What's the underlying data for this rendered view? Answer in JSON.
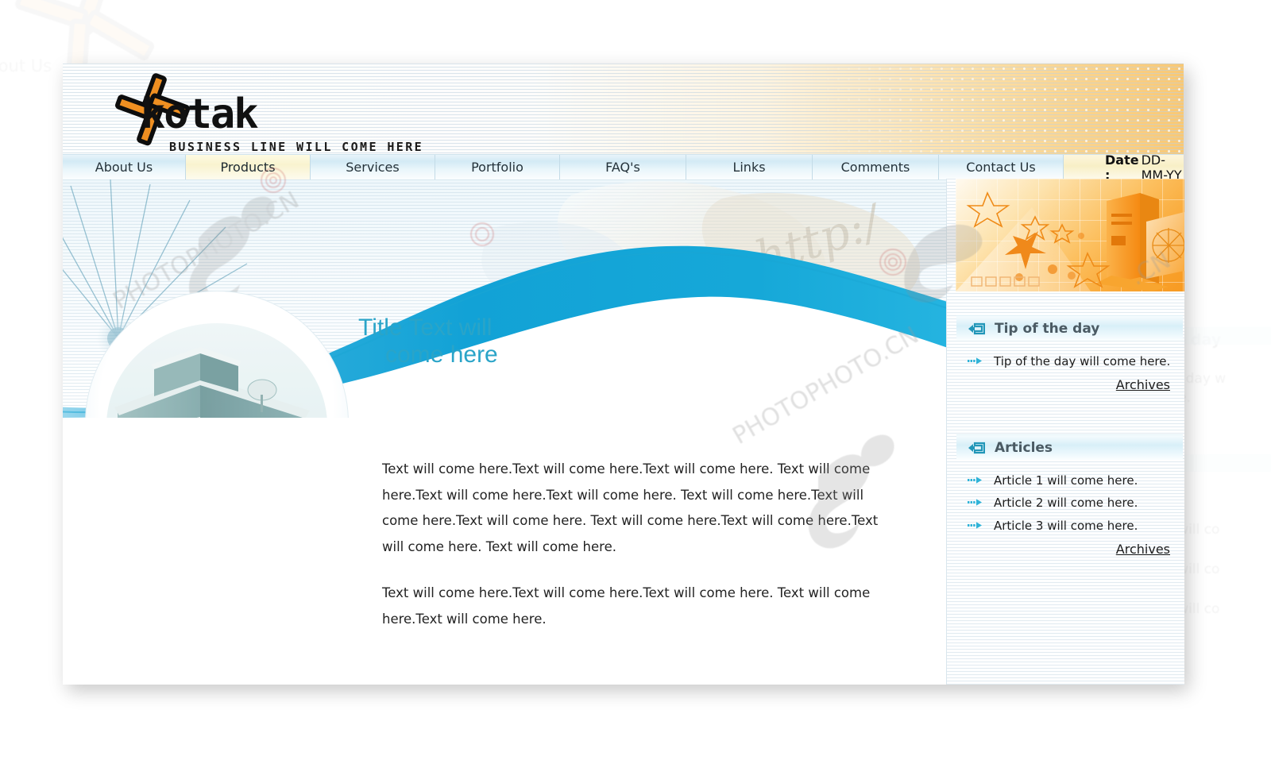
{
  "brand": {
    "name": "kotak",
    "tagline": "Business Line will come here",
    "logo_icon": "pinwheel-logo-icon",
    "logo_colors": {
      "orange": "#ef8f21",
      "black": "#111111"
    }
  },
  "nav": {
    "items": [
      {
        "label": "About Us",
        "active": false
      },
      {
        "label": "Products",
        "active": true
      },
      {
        "label": "Services",
        "active": false
      },
      {
        "label": "Portfolio",
        "active": false
      },
      {
        "label": "FAQ's",
        "active": false
      },
      {
        "label": "Links",
        "active": false
      },
      {
        "label": "Comments",
        "active": false
      },
      {
        "label": "Contact Us",
        "active": false
      }
    ],
    "date_label": "Date :",
    "date_value": "DD-MM-YY"
  },
  "hero": {
    "title_line1": "Title Text will",
    "title_line2": "come here",
    "title_color": "#2aa4c8",
    "wave_color": "#19a5d4",
    "photo_name": "office-building-photo",
    "watermark_text": "http://"
  },
  "main": {
    "paragraphs": [
      "Text will come here.Text will come here.Text will come here. Text will come here.Text will come here.Text will come here. Text will come here.Text will come here.Text will come here. Text will come here.Text will come here.Text will come here. Text will come here.",
      "Text will come here.Text will come here.Text will come here. Text will come here.Text will come here."
    ]
  },
  "sidebar": {
    "banner_name": "orange-computer-graphic",
    "sections": [
      {
        "title": "Tip of the day",
        "icon": "arrow-into-box-icon",
        "items": [
          "Tip of the day will come here."
        ],
        "archives_label": "Archives"
      },
      {
        "title": "Articles",
        "icon": "arrow-into-box-icon",
        "items": [
          "Article 1 will come here.",
          "Article 2 will come here.",
          "Article 3 will come here."
        ],
        "archives_label": "Archives"
      }
    ]
  },
  "colors": {
    "accent_blue": "#19a5d4",
    "accent_orange": "#f79a22",
    "nav_blue": "#d3eaf5",
    "nav_active": "#f9f3cf"
  }
}
